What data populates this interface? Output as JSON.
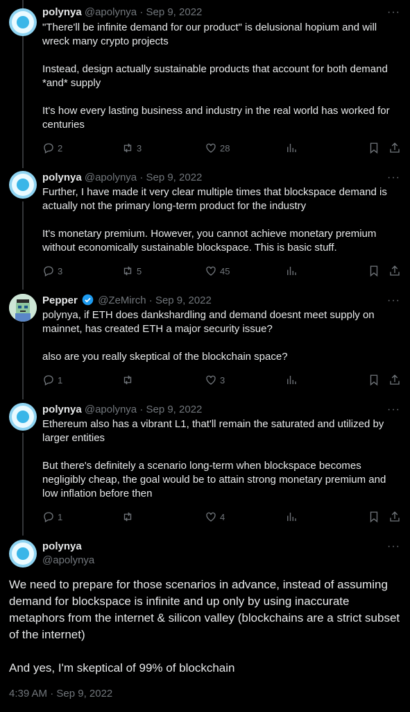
{
  "tweets": [
    {
      "name": "polynya",
      "handle": "@apolynya",
      "date": "· Sep 9, 2022",
      "text": "\"There'll be infinite demand for our product\" is delusional hopium and will wreck many crypto projects\n\nInstead, design actually sustainable products that account for both demand *and* supply\n\nIt's how every lasting business and industry in the real world has worked for centuries",
      "replies": "2",
      "retweets": "3",
      "likes": "28"
    },
    {
      "name": "polynya",
      "handle": "@apolynya",
      "date": "· Sep 9, 2022",
      "text": "Further, I have made it very clear multiple times that blockspace demand is actually not the primary long-term product for the industry\n\nIt's monetary premium. However, you cannot achieve monetary premium without economically sustainable blockspace. This is basic stuff.",
      "replies": "3",
      "retweets": "5",
      "likes": "45"
    },
    {
      "name": "Pepper",
      "handle": "@ZeMirch",
      "date": "· Sep 9, 2022",
      "text": "polynya, if ETH does dankshardling and demand doesnt meet supply on mainnet, has created ETH a major security issue?\n\nalso are you really skeptical of the blockchain space?",
      "replies": "1",
      "retweets": "",
      "likes": "3"
    },
    {
      "name": "polynya",
      "handle": "@apolynya",
      "date": "· Sep 9, 2022",
      "text": "Ethereum also has a vibrant L1, that'll remain the saturated and utilized by larger entities\n\nBut there's definitely a scenario long-term when blockspace becomes negligibly cheap, the goal would be to attain strong monetary premium and low inflation before then",
      "replies": "1",
      "retweets": "",
      "likes": "4"
    }
  ],
  "main": {
    "name": "polynya",
    "handle": "@apolynya",
    "text": "We need to prepare for those scenarios in advance, instead of assuming demand for blockspace is infinite and up only by using inaccurate metaphors from the internet & silicon valley (blockchains are a strict subset of the internet)\n\nAnd yes, I'm skeptical of 99% of blockchain",
    "timestamp": "4:39 AM · Sep 9, 2022"
  },
  "more_label": "···",
  "colors": {
    "background": "#000000",
    "text": "#e7e9ea",
    "muted": "#71767b",
    "verified": "#1d9bf0"
  }
}
